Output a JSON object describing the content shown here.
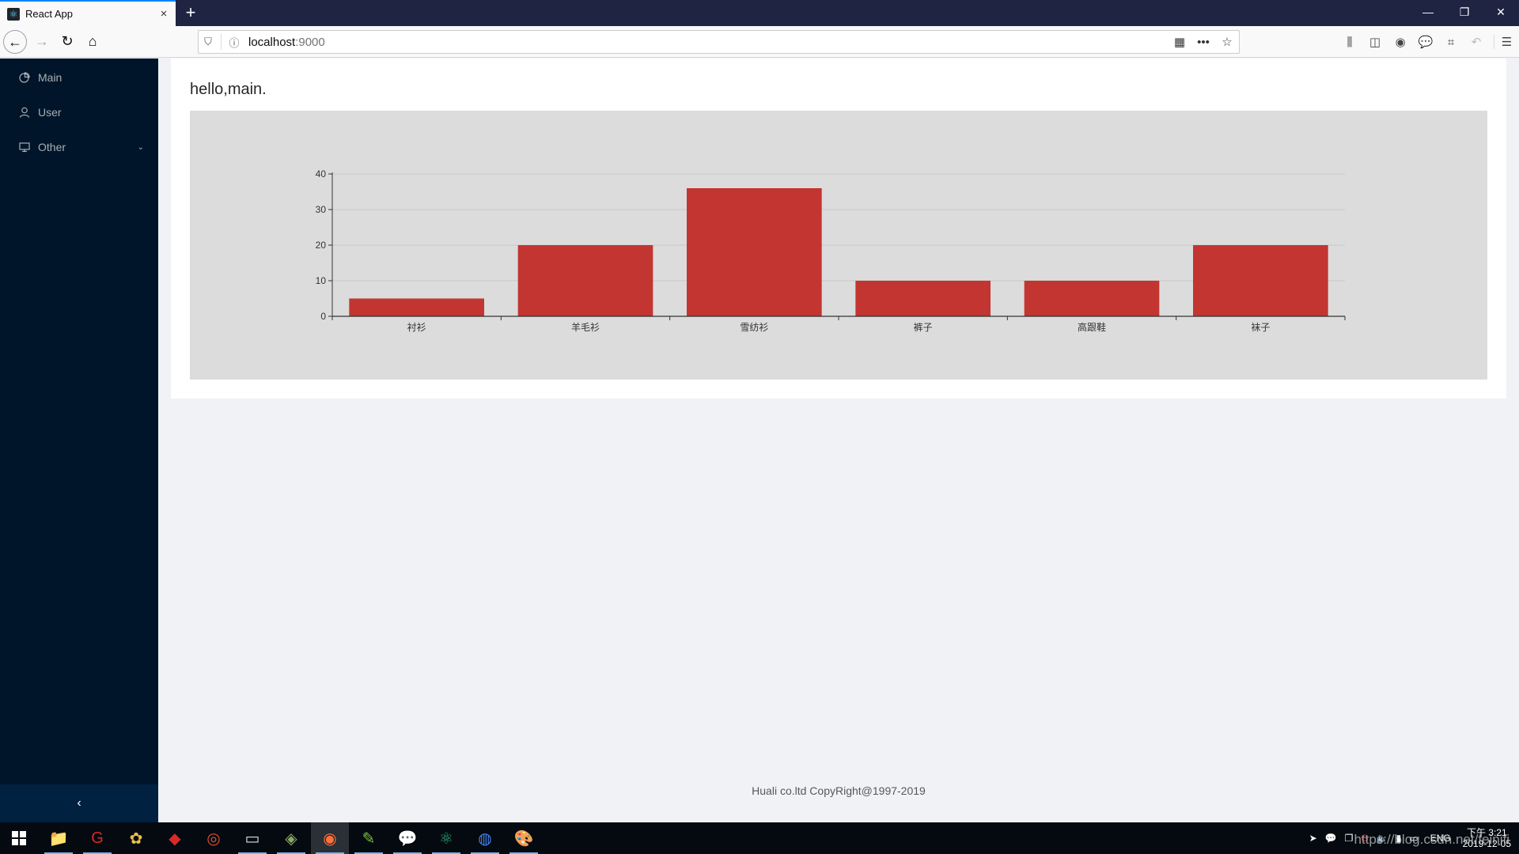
{
  "browser": {
    "tab_title": "React App",
    "tab_close": "×",
    "new_tab": "+",
    "url_host": "localhost",
    "url_port": ":9000",
    "window_controls": {
      "minimize": "—",
      "restore": "❐",
      "close": "✕"
    },
    "nav": {
      "back": "←",
      "forward": "→",
      "reload": "↻",
      "home": "⌂"
    },
    "url_icons": {
      "shield": "⛉",
      "info": "ⓘ",
      "qr": "▦",
      "more": "•••",
      "star": "☆"
    },
    "toolbar_icons": {
      "library": "⫼",
      "sidebar": "◫",
      "account": "◉",
      "chat": "💬",
      "crop": "⌗",
      "undo": "↶",
      "menu": "☰"
    }
  },
  "sidebar": {
    "items": [
      {
        "label": "Main",
        "icon": "pie-chart-icon",
        "glyph": "◔"
      },
      {
        "label": "User",
        "icon": "user-icon",
        "glyph": "♙"
      },
      {
        "label": "Other",
        "icon": "desktop-icon",
        "glyph": "🖵",
        "arrow": "⌄"
      }
    ],
    "collapse_glyph": "‹"
  },
  "main": {
    "greeting": "hello,main."
  },
  "chart_data": {
    "type": "bar",
    "title": "",
    "categories": [
      "衬衫",
      "羊毛衫",
      "雪纺衫",
      "裤子",
      "高跟鞋",
      "袜子"
    ],
    "values": [
      5,
      20,
      36,
      10,
      10,
      20
    ],
    "series": [
      {
        "name": "",
        "values": [
          5,
          20,
          36,
          10,
          10,
          20
        ],
        "color": "#c23531"
      }
    ],
    "xlabel": "",
    "ylabel": "",
    "ylim": [
      0,
      40
    ],
    "yticks": [
      0,
      10,
      20,
      30,
      40
    ],
    "grid": true,
    "legend": "none",
    "background": "#dcdcdc"
  },
  "footer": {
    "text": "Huali co.ltd CopyRight@1997-2019"
  },
  "taskbar": {
    "start_glyph": "⊞",
    "apps": [
      {
        "name": "file-explorer",
        "glyph": "📁"
      },
      {
        "name": "app-red-g",
        "glyph": "G"
      },
      {
        "name": "app-yellow",
        "glyph": "✿"
      },
      {
        "name": "redis",
        "glyph": "◆"
      },
      {
        "name": "app-snail",
        "glyph": "◎"
      },
      {
        "name": "terminal",
        "glyph": "▭"
      },
      {
        "name": "git-app",
        "glyph": "◈"
      },
      {
        "name": "firefox",
        "glyph": "◉"
      },
      {
        "name": "notepad",
        "glyph": "✎"
      },
      {
        "name": "wechat",
        "glyph": "💬"
      },
      {
        "name": "atom",
        "glyph": "⚛"
      },
      {
        "name": "chrome",
        "glyph": "◍"
      },
      {
        "name": "paint",
        "glyph": "🎨"
      }
    ],
    "tray": {
      "icons": [
        "➤",
        "💬",
        "❐",
        "G",
        "🔈",
        "▮",
        "▭"
      ],
      "lang": "ENG",
      "time": "下午 3:21",
      "date": "2019-12-05"
    },
    "watermark": "https://blog.csdn.net/feinifi"
  }
}
